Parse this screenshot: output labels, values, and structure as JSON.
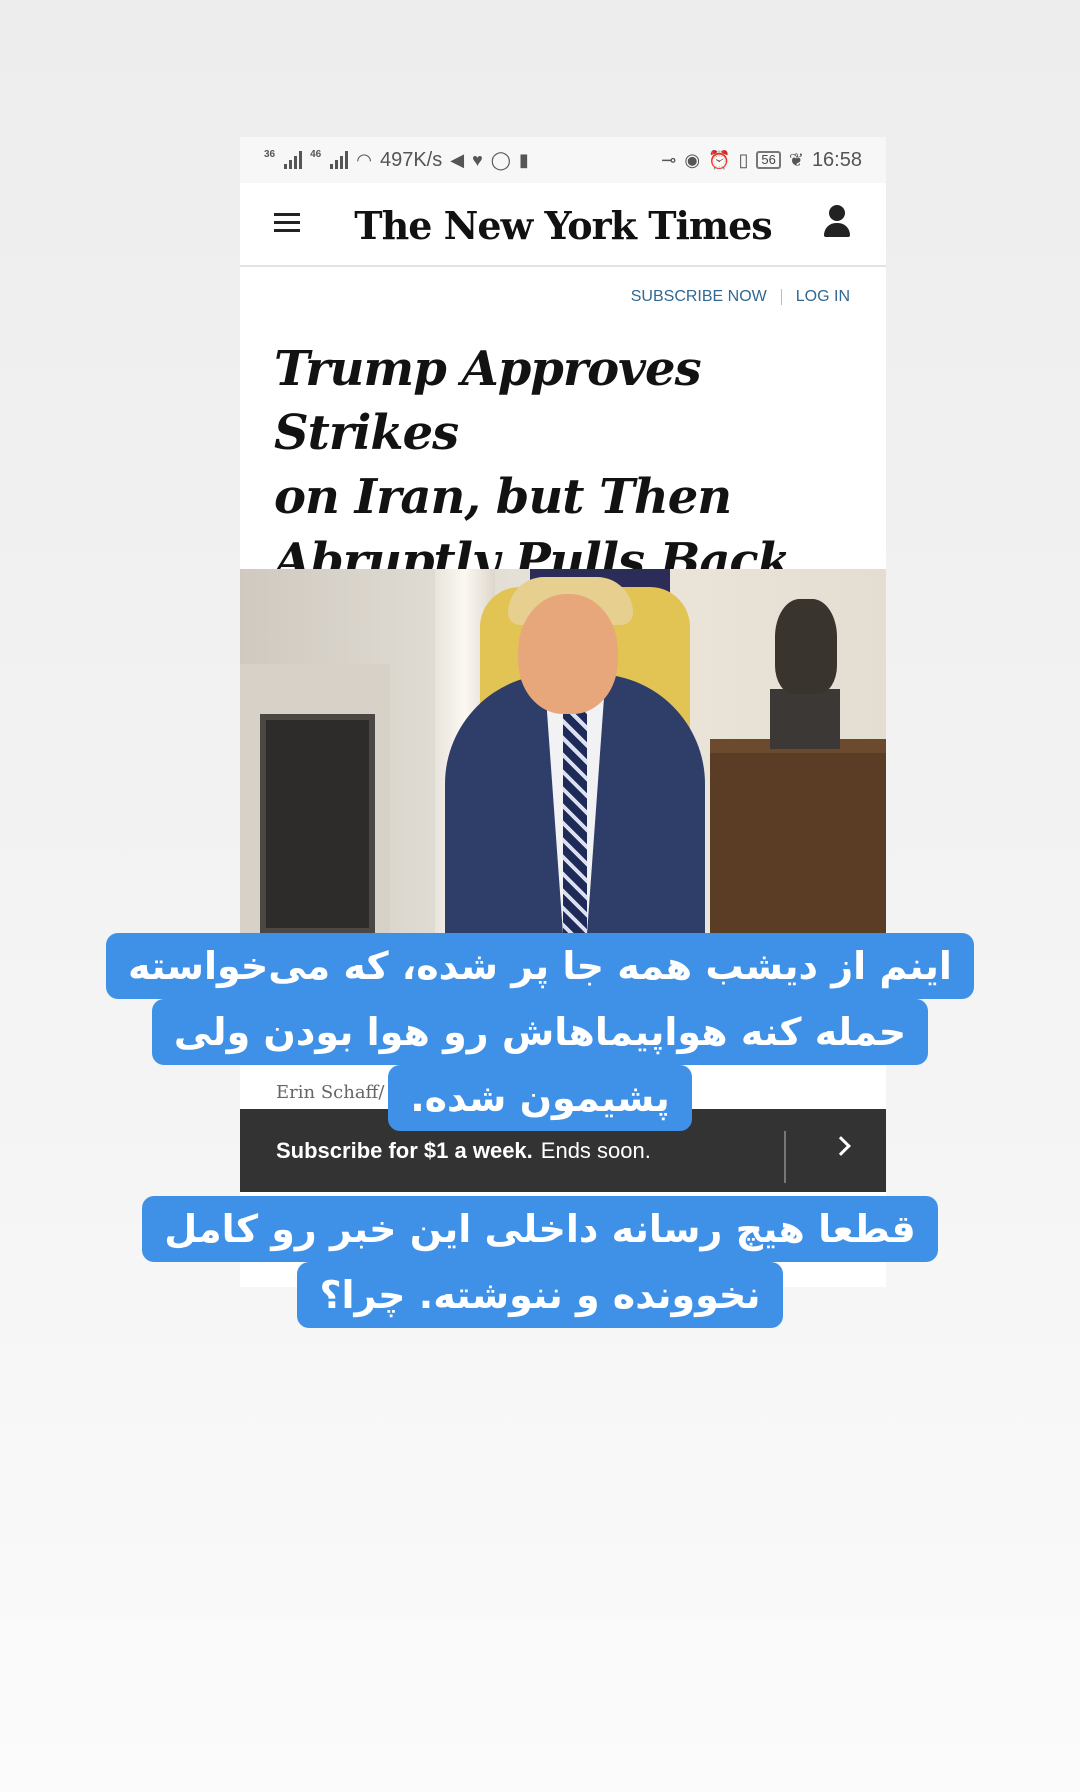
{
  "status_bar": {
    "signal_1": "36",
    "signal_2": "46",
    "net_speed": "497K/s",
    "battery": "56",
    "time": "16:58"
  },
  "header": {
    "logo": "The New York Times"
  },
  "account_links": {
    "subscribe": "SUBSCRIBE NOW",
    "login": "LOG IN"
  },
  "article": {
    "headline_lines": [
      "Trump Approves Strikes",
      "on Iran, but Then",
      "Abruptly Pulls Back"
    ],
    "photo_credit": "Erin Schaff/"
  },
  "subscribe_bar": {
    "offer": "Subscribe for $1 a week.",
    "note": "Ends soon."
  },
  "overlay": {
    "caption1_lines": [
      "اینم از دیشب همه جا پر شده، که می‌خواسته",
      "حمله کنه هواپیماهاش رو هوا بودن ولی",
      "پشیمون شده."
    ],
    "caption2_lines": [
      "قطعا هیچ رسانه داخلی این خبر رو کامل",
      "نخوونده و ننوشته. چرا؟"
    ]
  },
  "colors": {
    "link_blue": "#326891",
    "caption_blue": "#3f91e7",
    "subscribe_bar_bg": "#333333"
  }
}
